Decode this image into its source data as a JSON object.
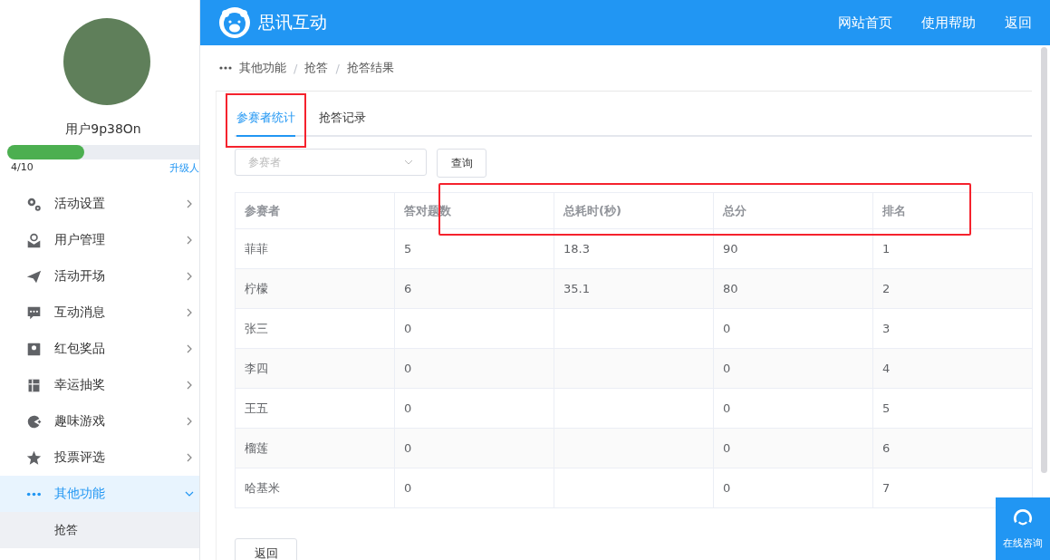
{
  "sidebar": {
    "username": "用户9p38On",
    "quota": {
      "level": 0.4,
      "reading": "4/10",
      "upgrade_link": "升级人"
    },
    "items": [
      {
        "label": "活动设置",
        "selected": false,
        "expanded": false
      },
      {
        "label": "用户管理",
        "selected": false,
        "expanded": false
      },
      {
        "label": "活动开场",
        "selected": false,
        "expanded": false
      },
      {
        "label": "互动消息",
        "selected": false,
        "expanded": false
      },
      {
        "label": "红包奖品",
        "selected": false,
        "expanded": false
      },
      {
        "label": "幸运抽奖",
        "selected": false,
        "expanded": false
      },
      {
        "label": "趣味游戏",
        "selected": false,
        "expanded": false
      },
      {
        "label": "投票评选",
        "selected": false,
        "expanded": false
      },
      {
        "label": "其他功能",
        "selected": true,
        "expanded": true,
        "children": [
          {
            "label": "抢答",
            "selected": false
          }
        ]
      }
    ]
  },
  "header": {
    "brand": "思讯互动",
    "links": [
      "网站首页",
      "使用帮助",
      "返回"
    ]
  },
  "breadcrumb": {
    "separator": "/",
    "items": [
      "其他功能",
      "抢答",
      "抢答结果"
    ]
  },
  "tabs": [
    {
      "label": "参赛者统计",
      "selected": true,
      "highlighted": true
    },
    {
      "label": "抢答记录",
      "selected": false,
      "highlighted": false
    }
  ],
  "filter": {
    "placeholder": "参赛者",
    "button": "查询"
  },
  "table": {
    "header_highlighted": true,
    "columns": [
      "参赛者",
      "答对题数",
      "总耗时(秒)",
      "总分",
      "排名"
    ],
    "rows": [
      [
        "菲菲",
        "5",
        "18.3",
        "90",
        "1"
      ],
      [
        "柠檬",
        "6",
        "35.1",
        "80",
        "2"
      ],
      [
        "张三",
        "0",
        "",
        "0",
        "3"
      ],
      [
        "李四",
        "0",
        "",
        "0",
        "4"
      ],
      [
        "王五",
        "0",
        "",
        "0",
        "5"
      ],
      [
        "榴莲",
        "0",
        "",
        "0",
        "6"
      ],
      [
        "哈基米",
        "0",
        "",
        "0",
        "7"
      ]
    ]
  },
  "back_button": "返回",
  "consult_button": "在线咨询"
}
